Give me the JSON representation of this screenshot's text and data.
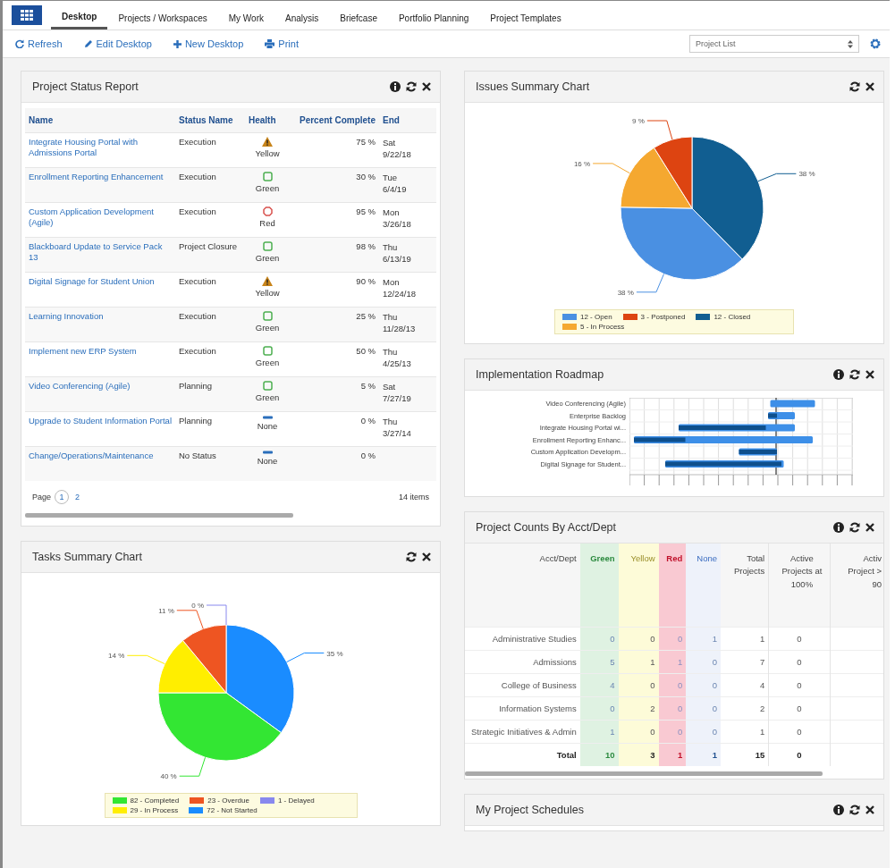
{
  "tabs": [
    {
      "label": "Desktop",
      "selected": true
    },
    {
      "label": "Projects / Workspaces",
      "selected": false
    },
    {
      "label": "My Work",
      "selected": false
    },
    {
      "label": "Analysis",
      "selected": false
    },
    {
      "label": "Briefcase",
      "selected": false
    },
    {
      "label": "Portfolio Planning",
      "selected": false
    },
    {
      "label": "Project Templates",
      "selected": false
    }
  ],
  "toolbar": [
    {
      "label": "Refresh",
      "kind": "refresh"
    },
    {
      "label": "Edit Desktop",
      "kind": "edit"
    },
    {
      "label": "New Desktop",
      "kind": "add"
    },
    {
      "label": "Print",
      "kind": "print"
    }
  ],
  "desktop_select": {
    "value": "Project List"
  },
  "status_report": {
    "title": "Project Status Report",
    "columns": [
      "Name",
      "Status Name",
      "Health",
      "Percent Complete",
      "End"
    ],
    "rows": [
      {
        "name": "Integrate Housing Portal with Admissions Portal",
        "status": "Execution",
        "health": "Yellow",
        "kind": "warning",
        "percent": "75 %",
        "end": [
          "Sat",
          "9/22/18"
        ]
      },
      {
        "name": "Enrollment Reporting Enhancement",
        "status": "Execution",
        "health": "Green",
        "kind": "ok",
        "percent": "30 %",
        "end": [
          "Tue",
          "6/4/19"
        ]
      },
      {
        "name": "Custom Application Development (Agile)",
        "status": "Execution",
        "health": "Red",
        "kind": "bad",
        "percent": "95 %",
        "end": [
          "Mon",
          "3/26/18"
        ]
      },
      {
        "name": "Blackboard Update to Service Pack 13",
        "status": "Project Closure",
        "health": "Green",
        "kind": "ok",
        "percent": "98 %",
        "end": [
          "Thu",
          "6/13/19"
        ]
      },
      {
        "name": "Digital Signage for Student Union",
        "status": "Execution",
        "health": "Yellow",
        "kind": "warning",
        "percent": "90 %",
        "end": [
          "Mon",
          "12/24/18"
        ]
      },
      {
        "name": "Learning Innovation",
        "status": "Execution",
        "health": "Green",
        "kind": "ok",
        "percent": "25 %",
        "end": [
          "Thu",
          "11/28/13"
        ]
      },
      {
        "name": "Implement new ERP System",
        "status": "Execution",
        "health": "Green",
        "kind": "ok",
        "percent": "50 %",
        "end": [
          "Thu",
          "4/25/13"
        ]
      },
      {
        "name": "Video Conferencing (Agile)",
        "status": "Planning",
        "health": "Green",
        "kind": "ok",
        "percent": "5 %",
        "end": [
          "Sat",
          "7/27/19"
        ]
      },
      {
        "name": "Upgrade to Student Information Portal",
        "status": "Planning",
        "health": "None",
        "kind": "none",
        "percent": "0 %",
        "end": [
          "Thu",
          "3/27/14"
        ]
      },
      {
        "name": "Change/Operations/Maintenance",
        "status": "No Status",
        "health": "None",
        "kind": "none",
        "percent": "0 %",
        "end": []
      }
    ],
    "pager": {
      "label": "Page",
      "pages": [
        {
          "label": "1",
          "selected": true
        },
        {
          "label": "2",
          "selected": false
        }
      ],
      "count": "14 items"
    }
  },
  "tasks_chart": {
    "title": "Tasks Summary Chart",
    "chart_data": {
      "type": "pie",
      "categories": [
        "72 - Not Started",
        "82 - Completed",
        "29 - In Process",
        "23 - Overdue",
        "1 - Delayed"
      ],
      "values": [
        35,
        40,
        14,
        11,
        0
      ],
      "value_labels": [
        "35 %",
        "40 %",
        "14 %",
        "11 %",
        "0 %"
      ],
      "colors": [
        "#1a8cff",
        "#33e633",
        "#ffee00",
        "#ee5522",
        "#8888ee"
      ],
      "legend": "bottom"
    }
  },
  "issues_chart": {
    "title": "Issues Summary Chart",
    "chart_data": {
      "type": "pie",
      "categories": [
        "12 - Closed",
        "12 - Open",
        "5 - In Process",
        "3 - Postponed"
      ],
      "values": [
        38,
        38,
        16,
        9
      ],
      "value_labels": [
        "38 %",
        "38 %",
        "16 %",
        "9 %"
      ],
      "colors": [
        "#115e91",
        "#4a90e2",
        "#f5a830",
        "#dd4411"
      ],
      "legend": "bottom"
    }
  },
  "roadmap": {
    "title": "Implementation Roadmap",
    "projects": [
      "Video Conferencing (Agile)",
      "Enterprise Backlog",
      "Integrate Housing Portal wi...",
      "Enrollment Reporting Enhanc...",
      "Custom Application Developm...",
      "Digital Signage for Student..."
    ]
  },
  "counts": {
    "title": "Project Counts By Acct/Dept",
    "columns": [
      {
        "label": "Acct/Dept"
      },
      {
        "label": "Green",
        "color": "#dff2e2"
      },
      {
        "label": "Yellow",
        "color": "#fdfbd8"
      },
      {
        "label": "Red",
        "color": "#f9c9d2"
      },
      {
        "label": "None",
        "color": "#eef2fa"
      },
      {
        "label": "Total Projects"
      },
      {
        "label": "Active Projects at 100%"
      },
      {
        "label": "Activ Project > 90"
      }
    ],
    "rows": [
      [
        "Administrative Studies",
        "0",
        "0",
        "0",
        "1",
        "1",
        "0"
      ],
      [
        "Admissions",
        "5",
        "1",
        "1",
        "0",
        "7",
        "0"
      ],
      [
        "College of Business",
        "4",
        "0",
        "0",
        "0",
        "4",
        "0"
      ],
      [
        "Information Systems",
        "0",
        "2",
        "0",
        "0",
        "2",
        "0"
      ],
      [
        "Strategic Initiatives & Admin",
        "1",
        "0",
        "0",
        "0",
        "1",
        "0"
      ]
    ],
    "total": [
      "Total",
      "10",
      "3",
      "1",
      "1",
      "15",
      "0"
    ]
  },
  "schedules": {
    "title": "My Project Schedules"
  }
}
